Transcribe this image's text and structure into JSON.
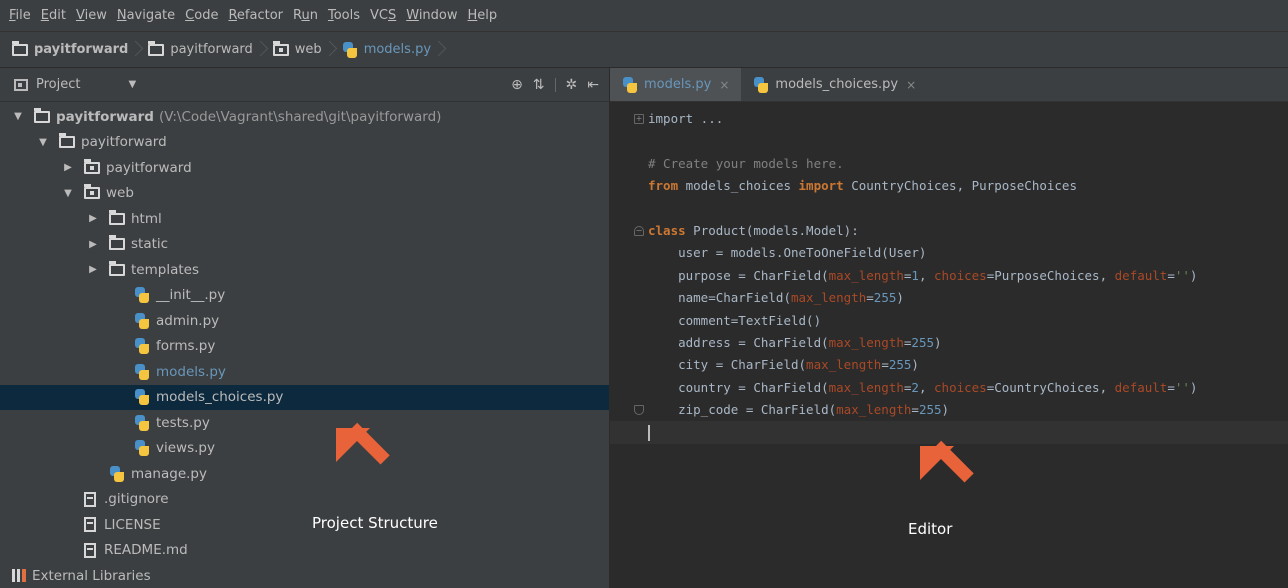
{
  "menu": [
    {
      "u": "F",
      "rest": "ile"
    },
    {
      "u": "E",
      "rest": "dit"
    },
    {
      "u": "V",
      "rest": "iew"
    },
    {
      "u": "N",
      "rest": "avigate"
    },
    {
      "u": "C",
      "rest": "ode"
    },
    {
      "u": "R",
      "rest": "efactor"
    },
    {
      "pre": "R",
      "u": "u",
      "rest": "n"
    },
    {
      "u": "T",
      "rest": "ools"
    },
    {
      "pre": "VC",
      "u": "S",
      "rest": ""
    },
    {
      "u": "W",
      "rest": "indow"
    },
    {
      "u": "H",
      "rest": "elp"
    }
  ],
  "breadcrumb": [
    {
      "label": "payitforward",
      "icon": "folder-icon",
      "bold": true
    },
    {
      "label": "payitforward",
      "icon": "folder-icon"
    },
    {
      "label": "web",
      "icon": "package-icon"
    },
    {
      "label": "models.py",
      "icon": "python-file-icon",
      "current": true
    }
  ],
  "project_panel": {
    "title": "Project",
    "tree": [
      {
        "label": "payitforward",
        "path": "(V:\\Code\\Vagrant\\shared\\git\\payitforward)",
        "depth": 0,
        "arrow": "down",
        "icon": "folder",
        "bold": true
      },
      {
        "label": "payitforward",
        "depth": 1,
        "arrow": "down",
        "icon": "folder"
      },
      {
        "label": "payitforward",
        "depth": 2,
        "arrow": "right",
        "icon": "package"
      },
      {
        "label": "web",
        "depth": 2,
        "arrow": "down",
        "icon": "package"
      },
      {
        "label": "html",
        "depth": 3,
        "arrow": "right",
        "icon": "folder"
      },
      {
        "label": "static",
        "depth": 3,
        "arrow": "right",
        "icon": "folder"
      },
      {
        "label": "templates",
        "depth": 3,
        "arrow": "right",
        "icon": "folder"
      },
      {
        "label": "__init__.py",
        "depth": 4,
        "arrow": "none",
        "icon": "python"
      },
      {
        "label": "admin.py",
        "depth": 4,
        "arrow": "none",
        "icon": "python"
      },
      {
        "label": "forms.py",
        "depth": 4,
        "arrow": "none",
        "icon": "python"
      },
      {
        "label": "models.py",
        "depth": 4,
        "arrow": "none",
        "icon": "python",
        "current": true
      },
      {
        "label": "models_choices.py",
        "depth": 4,
        "arrow": "none",
        "icon": "python",
        "selected": true
      },
      {
        "label": "tests.py",
        "depth": 4,
        "arrow": "none",
        "icon": "python"
      },
      {
        "label": "views.py",
        "depth": 4,
        "arrow": "none",
        "icon": "python"
      },
      {
        "label": "manage.py",
        "depth": 3,
        "arrow": "none",
        "icon": "python"
      },
      {
        "label": ".gitignore",
        "depth": 2,
        "arrow": "none",
        "icon": "file"
      },
      {
        "label": "LICENSE",
        "depth": 2,
        "arrow": "none",
        "icon": "file"
      },
      {
        "label": "README.md",
        "depth": 2,
        "arrow": "none",
        "icon": "file"
      },
      {
        "label": "External Libraries",
        "depth": 0,
        "arrow": "none",
        "icon": "library",
        "nopad": true
      }
    ]
  },
  "editor": {
    "tabs": [
      {
        "label": "models.py",
        "active": true
      },
      {
        "label": "models_choices.py",
        "active": false
      }
    ],
    "code": [
      [
        {
          "t": "fold",
          "v": "import ..."
        }
      ],
      [],
      [
        {
          "t": "cm",
          "v": "# Create your models here."
        }
      ],
      [
        {
          "t": "kw",
          "v": "from"
        },
        {
          "v": " models_choices "
        },
        {
          "t": "kw",
          "v": "import"
        },
        {
          "v": " CountryChoices, PurposeChoices"
        }
      ],
      [],
      [
        {
          "t": "kw",
          "v": "class"
        },
        {
          "v": " Product(models.Model):"
        }
      ],
      [
        {
          "v": "    user = models.OneToOneField(User)"
        }
      ],
      [
        {
          "v": "    purpose = CharField("
        },
        {
          "t": "kwarg",
          "v": "max_length"
        },
        {
          "v": "="
        },
        {
          "t": "num",
          "v": "1"
        },
        {
          "v": ", "
        },
        {
          "t": "kwarg",
          "v": "choices"
        },
        {
          "v": "=PurposeChoices, "
        },
        {
          "t": "kwarg",
          "v": "default"
        },
        {
          "v": "="
        },
        {
          "t": "str",
          "v": "''"
        },
        {
          "v": ")"
        }
      ],
      [
        {
          "v": "    name=CharField("
        },
        {
          "t": "kwarg",
          "v": "max_length"
        },
        {
          "v": "="
        },
        {
          "t": "num",
          "v": "255"
        },
        {
          "v": ")"
        }
      ],
      [
        {
          "v": "    comment=TextField()"
        }
      ],
      [
        {
          "v": "    address = CharField("
        },
        {
          "t": "kwarg",
          "v": "max_length"
        },
        {
          "v": "="
        },
        {
          "t": "num",
          "v": "255"
        },
        {
          "v": ")"
        }
      ],
      [
        {
          "v": "    city = CharField("
        },
        {
          "t": "kwarg",
          "v": "max_length"
        },
        {
          "v": "="
        },
        {
          "t": "num",
          "v": "255"
        },
        {
          "v": ")"
        }
      ],
      [
        {
          "v": "    country = CharField("
        },
        {
          "t": "kwarg",
          "v": "max_length"
        },
        {
          "v": "="
        },
        {
          "t": "num",
          "v": "2"
        },
        {
          "v": ", "
        },
        {
          "t": "kwarg",
          "v": "choices"
        },
        {
          "v": "=CountryChoices, "
        },
        {
          "t": "kwarg",
          "v": "default"
        },
        {
          "v": "="
        },
        {
          "t": "str",
          "v": "''"
        },
        {
          "v": ")"
        }
      ],
      [
        {
          "v": "    zip_code = CharField("
        },
        {
          "t": "kwarg",
          "v": "max_length"
        },
        {
          "v": "="
        },
        {
          "t": "num",
          "v": "255"
        },
        {
          "v": ")"
        }
      ],
      []
    ]
  },
  "annotations": {
    "project": "Project Structure",
    "editor": "Editor"
  },
  "colors": {
    "arrow": "#e8623a",
    "selection": "#0d293e",
    "current_file": "#6897bb"
  }
}
